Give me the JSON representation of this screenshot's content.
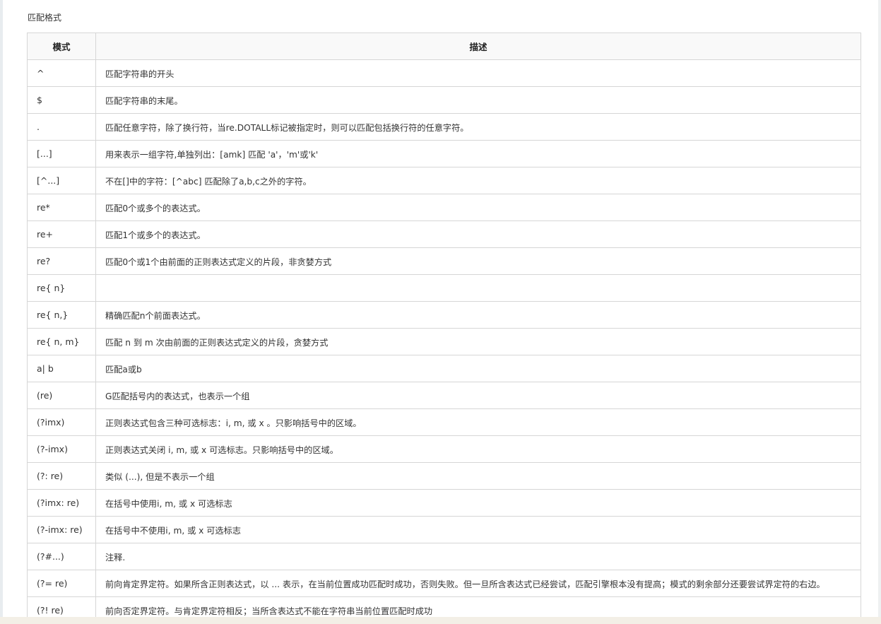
{
  "heading": "匹配格式",
  "table": {
    "headers": [
      "模式",
      "描述"
    ],
    "rows": [
      [
        "^",
        "匹配字符串的开头"
      ],
      [
        "$",
        "匹配字符串的末尾。"
      ],
      [
        ".",
        "匹配任意字符，除了换行符，当re.DOTALL标记被指定时，则可以匹配包括换行符的任意字符。"
      ],
      [
        "[...]",
        "用来表示一组字符,单独列出：[amk] 匹配 'a'，'m'或'k'"
      ],
      [
        "[^...]",
        "不在[]中的字符：[^abc] 匹配除了a,b,c之外的字符。"
      ],
      [
        "re*",
        "匹配0个或多个的表达式。"
      ],
      [
        "re+",
        "匹配1个或多个的表达式。"
      ],
      [
        "re?",
        "匹配0个或1个由前面的正则表达式定义的片段，非贪婪方式"
      ],
      [
        "re{ n}",
        ""
      ],
      [
        "re{ n,}",
        "精确匹配n个前面表达式。"
      ],
      [
        "re{ n, m}",
        "匹配 n 到 m 次由前面的正则表达式定义的片段，贪婪方式"
      ],
      [
        "a| b",
        "匹配a或b"
      ],
      [
        "(re)",
        "G匹配括号内的表达式，也表示一个组"
      ],
      [
        "(?imx)",
        "正则表达式包含三种可选标志：i, m, 或 x 。只影响括号中的区域。"
      ],
      [
        "(?-imx)",
        "正则表达式关闭 i, m, 或 x 可选标志。只影响括号中的区域。"
      ],
      [
        "(?: re)",
        "类似 (...), 但是不表示一个组"
      ],
      [
        "(?imx: re)",
        "在括号中使用i, m, 或 x 可选标志"
      ],
      [
        "(?-imx: re)",
        "在括号中不使用i, m, 或 x 可选标志"
      ],
      [
        "(?#...)",
        "注释."
      ],
      [
        "(?= re)",
        "前向肯定界定符。如果所含正则表达式，以 ... 表示，在当前位置成功匹配时成功，否则失败。但一旦所含表达式已经尝试，匹配引擎根本没有提高；模式的剩余部分还要尝试界定符的右边。"
      ],
      [
        "(?! re)",
        "前向否定界定符。与肯定界定符相反；当所含表达式不能在字符串当前位置匹配时成功"
      ]
    ]
  }
}
